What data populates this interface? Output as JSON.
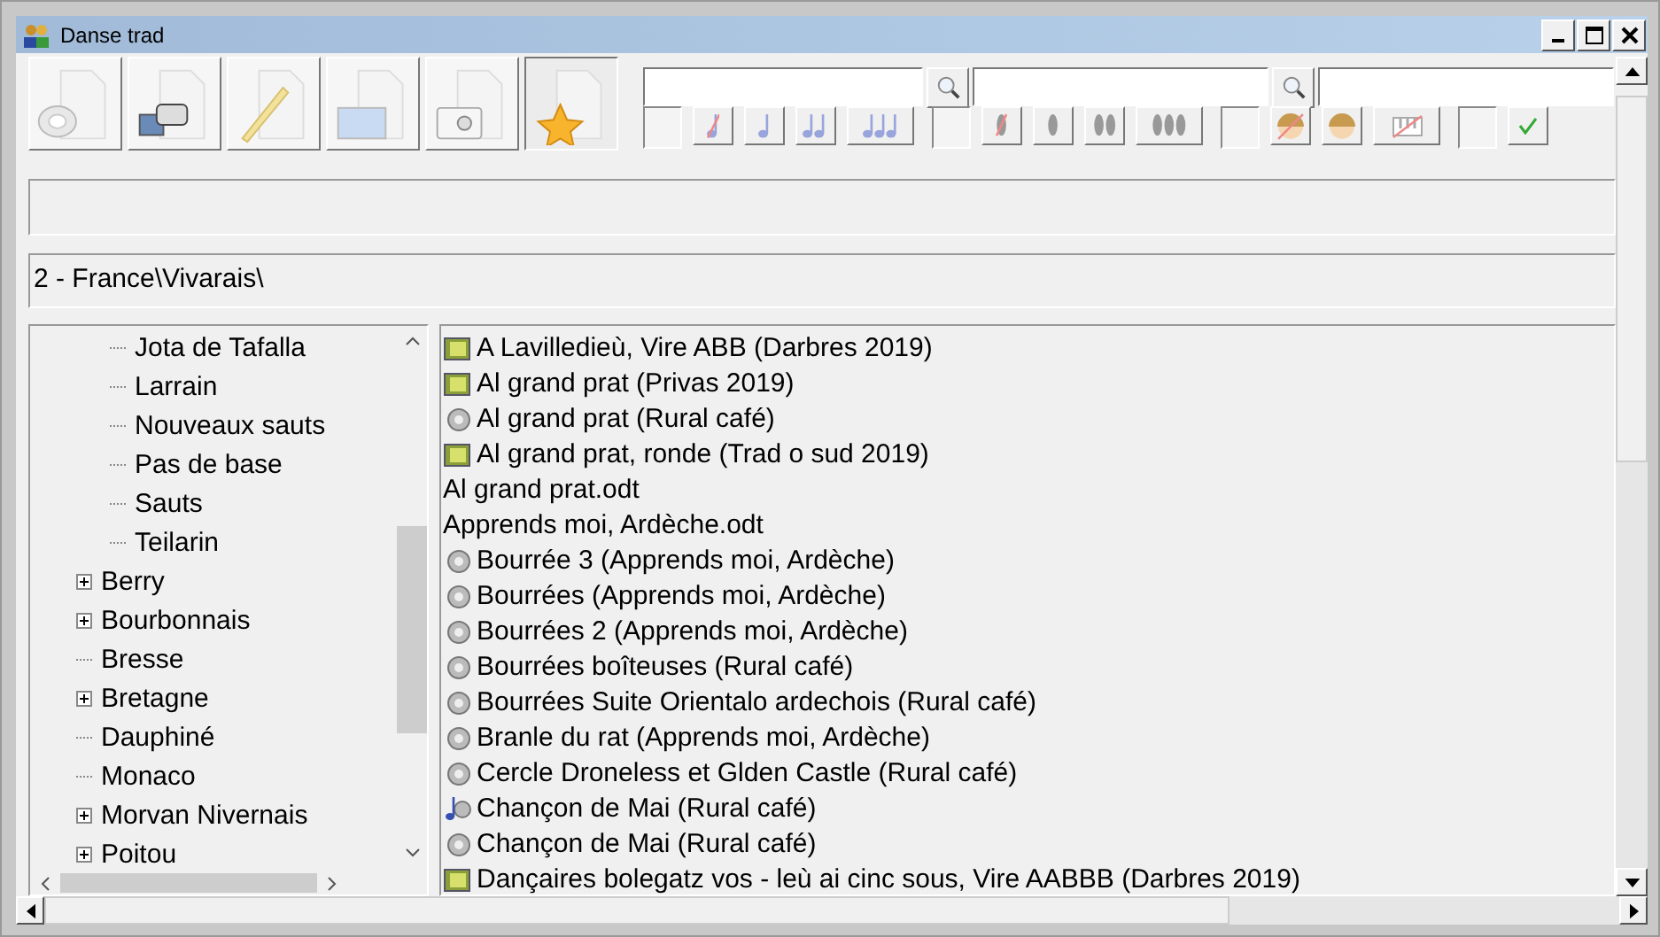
{
  "window": {
    "title": "Danse trad"
  },
  "toolbar": {
    "buttons": [
      {
        "kind": "audio",
        "selected": false
      },
      {
        "kind": "video",
        "selected": false
      },
      {
        "kind": "text",
        "selected": false
      },
      {
        "kind": "image",
        "selected": false
      },
      {
        "kind": "photo",
        "selected": false
      },
      {
        "kind": "favorite",
        "selected": true
      }
    ],
    "searches": [
      {
        "button": true
      },
      {
        "button": true
      },
      {
        "button": false
      }
    ],
    "filter_groups": [
      {
        "buttons": [
          {
            "kind": "no-note"
          },
          {
            "kind": "note1"
          },
          {
            "kind": "note2"
          },
          {
            "kind": "note3"
          }
        ]
      },
      {
        "buttons": [
          {
            "kind": "no-foot"
          },
          {
            "kind": "foot1"
          },
          {
            "kind": "foot2"
          },
          {
            "kind": "foot3"
          }
        ]
      },
      {
        "buttons": [
          {
            "kind": "no-child"
          },
          {
            "kind": "child"
          },
          {
            "kind": "no-piano"
          }
        ]
      },
      {
        "buttons": [
          {
            "kind": "check"
          }
        ]
      }
    ]
  },
  "path": {
    "value": "2 - France\\Vivarais\\"
  },
  "tree": {
    "items": [
      {
        "children": [
          {
            "label": "Jota de Tafalla",
            "expandable": false
          },
          {
            "label": "Larrain",
            "expandable": false
          },
          {
            "label": "Nouveaux sauts",
            "expandable": false
          },
          {
            "label": "Pas de base",
            "expandable": false
          },
          {
            "label": "Sauts",
            "expandable": false
          },
          {
            "label": "Teilarin",
            "expandable": false
          }
        ]
      },
      {
        "label": "Berry",
        "expandable": true
      },
      {
        "label": "Bourbonnais",
        "expandable": true
      },
      {
        "label": "Bresse",
        "expandable": false
      },
      {
        "label": "Bretagne",
        "expandable": true
      },
      {
        "label": "Dauphiné",
        "expandable": false
      },
      {
        "label": "Monaco",
        "expandable": false
      },
      {
        "label": "Morvan Nivernais",
        "expandable": true
      },
      {
        "label": "Poitou",
        "expandable": true
      }
    ]
  },
  "files": [
    {
      "kind": "video",
      "name": "A Lavilledieù, Vire ABB (Darbres 2019)"
    },
    {
      "kind": "video",
      "name": "Al grand prat (Privas 2019)"
    },
    {
      "kind": "audio",
      "name": "Al grand prat (Rural café)"
    },
    {
      "kind": "video",
      "name": "Al grand prat, ronde (Trad o sud 2019)"
    },
    {
      "kind": "document",
      "name": "Al grand prat.odt"
    },
    {
      "kind": "document",
      "name": "Apprends moi, Ardèche.odt"
    },
    {
      "kind": "audio",
      "name": "Bourrée 3 (Apprends moi, Ardèche)"
    },
    {
      "kind": "audio",
      "name": "Bourrées (Apprends moi, Ardèche)"
    },
    {
      "kind": "audio",
      "name": "Bourrées 2 (Apprends moi, Ardèche)"
    },
    {
      "kind": "audio",
      "name": "Bourrées boîteuses (Rural café)"
    },
    {
      "kind": "audio",
      "name": "Bourrées Suite Orientalo ardechois (Rural café)"
    },
    {
      "kind": "audio",
      "name": "Branle du rat (Apprends moi, Ardèche)"
    },
    {
      "kind": "audio",
      "name": "Cercle Droneless et Glden Castle (Rural café)"
    },
    {
      "kind": "music",
      "name": "Chançon de Mai (Rural café)"
    },
    {
      "kind": "audio",
      "name": "Chançon de Mai (Rural café)"
    },
    {
      "kind": "video",
      "name": "Dançaires bolegatz vos - leù ai cinc sous, Vire AABBB (Darbres 2019)"
    }
  ]
}
